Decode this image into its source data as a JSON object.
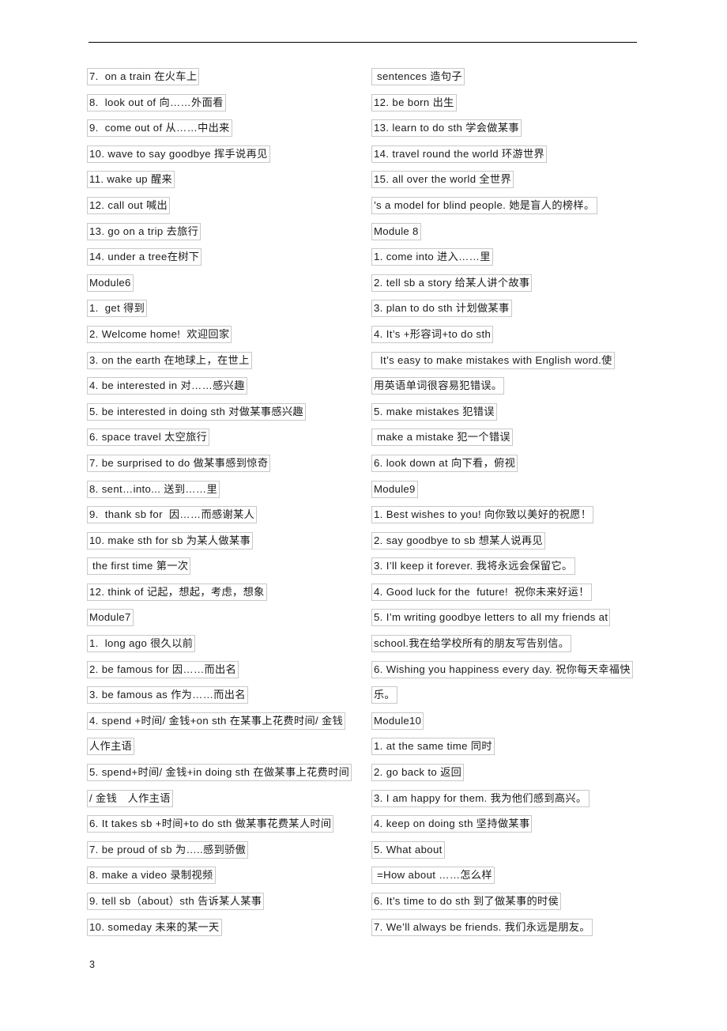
{
  "document": {
    "page_number": "3",
    "header_rule": true,
    "border_color": "#c8c8c8",
    "text_color": "#1a1a1a"
  },
  "left_column": {
    "lines": [
      {
        "text": "7.  on a train 在火车上",
        "kind": "item"
      },
      {
        "text": "8.  look out of 向……外面看",
        "kind": "item"
      },
      {
        "text": "9.  come out of 从……中出来",
        "kind": "item"
      },
      {
        "text": "10. wave to say goodbye 挥手说再见",
        "kind": "item"
      },
      {
        "text": "11. wake up 醒来",
        "kind": "item"
      },
      {
        "text": "12. call out 喊出",
        "kind": "item"
      },
      {
        "text": "13. go on a trip 去旅行",
        "kind": "item"
      },
      {
        "text": "14. under a tree在树下",
        "kind": "item"
      },
      {
        "text": "Module6",
        "kind": "heading"
      },
      {
        "text": "1.  get 得到",
        "kind": "item"
      },
      {
        "text": "2. Welcome home!  欢迎回家",
        "kind": "item"
      },
      {
        "text": "3. on the earth 在地球上，在世上",
        "kind": "item"
      },
      {
        "text": "4. be interested in 对……感兴趣",
        "kind": "item"
      },
      {
        "text": "5. be interested in doing sth 对做某事感兴趣",
        "kind": "item"
      },
      {
        "text": "6. space travel 太空旅行",
        "kind": "item"
      },
      {
        "text": "7. be surprised to do 做某事感到惊奇",
        "kind": "item"
      },
      {
        "text": "8. sent…into... 送到……里",
        "kind": "item"
      },
      {
        "text": "9.  thank sb for  因……而感谢某人",
        "kind": "item"
      },
      {
        "text": "10. make sth for sb 为某人做某事",
        "kind": "item"
      },
      {
        "text": " the first time 第一次",
        "kind": "indent"
      },
      {
        "text": "12. think of 记起，想起，考虑，想象",
        "kind": "item"
      },
      {
        "text": "Module7",
        "kind": "heading"
      },
      {
        "text": "1.  long ago 很久以前",
        "kind": "item"
      },
      {
        "text": "2. be famous for 因……而出名",
        "kind": "item"
      },
      {
        "text": "3. be famous as 作为……而出名",
        "kind": "item"
      },
      {
        "text": "4. spend +时间/ 金钱+on sth 在某事上花费时间/ 金钱",
        "kind": "item"
      },
      {
        "text": "人作主语",
        "kind": "wrap"
      },
      {
        "text": "5. spend+时间/ 金钱+in doing sth 在做某事上花费时间",
        "kind": "item"
      },
      {
        "text": "/ 金钱　人作主语",
        "kind": "wrap"
      },
      {
        "text": "6. It takes sb +时间+to do sth 做某事花费某人时间",
        "kind": "item"
      },
      {
        "text": "7. be proud of sb 为…..感到骄傲",
        "kind": "item"
      },
      {
        "text": "8. make a video 录制视频",
        "kind": "item"
      },
      {
        "text": "9. tell sb（about）sth 告诉某人某事",
        "kind": "item"
      },
      {
        "text": "10. someday 未来的某一天",
        "kind": "item"
      }
    ]
  },
  "right_column": {
    "lines": [
      {
        "text": " sentences 造句子",
        "kind": "indent"
      },
      {
        "text": "12. be born 出生",
        "kind": "item"
      },
      {
        "text": "13. learn to do sth 学会做某事",
        "kind": "item"
      },
      {
        "text": "14. travel round the world 环游世界",
        "kind": "item"
      },
      {
        "text": "15. all over the world 全世界",
        "kind": "item"
      },
      {
        "text": "’s a model for blind people. 她是盲人的榜样。",
        "kind": "item"
      },
      {
        "text": "Module 8",
        "kind": "heading"
      },
      {
        "text": "1. come into 进入……里",
        "kind": "item"
      },
      {
        "text": "2. tell sb a story 给某人讲个故事",
        "kind": "item"
      },
      {
        "text": "3. plan to do sth 计划做某事",
        "kind": "item"
      },
      {
        "text": "4. It’s +形容词+to do sth",
        "kind": "item"
      },
      {
        "text": "  It’s easy to make mistakes with English word.使",
        "kind": "indent"
      },
      {
        "text": "用英语单词很容易犯错误。",
        "kind": "wrap"
      },
      {
        "text": "5. make mistakes 犯错误",
        "kind": "item"
      },
      {
        "text": " make a mistake 犯一个错误",
        "kind": "indent"
      },
      {
        "text": "6. look down at 向下看，俯视",
        "kind": "item"
      },
      {
        "text": "Module9",
        "kind": "heading"
      },
      {
        "text": "1. Best wishes to you! 向你致以美好的祝愿！",
        "kind": "item"
      },
      {
        "text": "2. say goodbye to sb 想某人说再见",
        "kind": "item"
      },
      {
        "text": "3. I’ll keep it forever. 我将永远会保留它。",
        "kind": "item"
      },
      {
        "text": "4. Good luck for the  future!  祝你未来好运！",
        "kind": "item"
      },
      {
        "text": "5. I’m writing goodbye letters to all my friends at",
        "kind": "item"
      },
      {
        "text": "school.我在给学校所有的朋友写告别信。",
        "kind": "wrap"
      },
      {
        "text": "6. Wishing you happiness every day. 祝你每天幸福快",
        "kind": "item"
      },
      {
        "text": "乐。",
        "kind": "wrap"
      },
      {
        "text": "Module10",
        "kind": "heading"
      },
      {
        "text": "1. at the same time 同时",
        "kind": "item"
      },
      {
        "text": "2. go back to 返回",
        "kind": "item"
      },
      {
        "text": "3. I am happy for them. 我为他们感到高兴。",
        "kind": "item"
      },
      {
        "text": "4. keep on doing sth 坚持做某事",
        "kind": "item"
      },
      {
        "text": "5. What about",
        "kind": "item"
      },
      {
        "text": " =How about ……怎么样",
        "kind": "indent"
      },
      {
        "text": "6. It’s time to do sth 到了做某事的时侯",
        "kind": "item"
      },
      {
        "text": "7. We’ll always be friends. 我们永远是朋友。",
        "kind": "item"
      }
    ]
  }
}
